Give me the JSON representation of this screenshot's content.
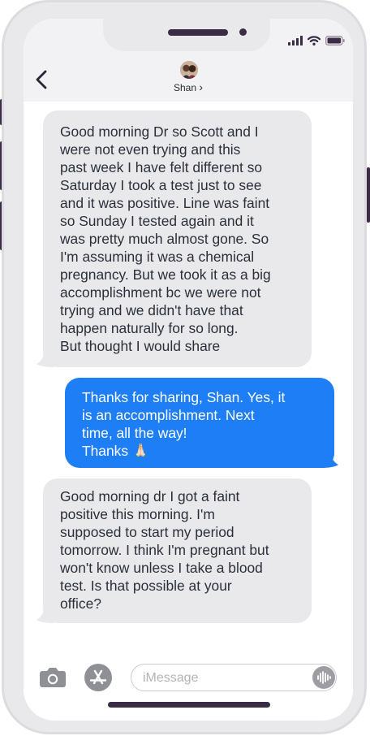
{
  "contact": {
    "name": "Shan",
    "chevron": "›"
  },
  "status": {
    "icons": [
      "cellular-signal-icon",
      "wifi-icon",
      "battery-icon"
    ]
  },
  "messages": [
    {
      "direction": "incoming",
      "text": "Good morning Dr so Scott and I\nwere not even trying and this\npast week I have felt different so\nSaturday I took a test just to see\nand it was positive. Line was faint\nso Sunday I tested again and it\nwas pretty much almost gone. So\nI'm assuming it was a chemical\npregnancy. But we took it as a big\naccomplishment bc we were not\ntrying and we didn't have that\nhappen naturally for so long.\nBut thought I would share"
    },
    {
      "direction": "outgoing",
      "text": "Thanks for sharing, Shan. Yes, it\nis an accomplishment. Next\ntime, all the way!\nThanks 🙏🏻"
    },
    {
      "direction": "incoming",
      "text": "Good morning dr I got a faint\npositive this morning. I'm\nsupposed to start my period\ntomorrow. I think I'm pregnant but\nwon't know unless I take a blood\ntest. Is that possible at your\noffice?"
    }
  ],
  "composer": {
    "placeholder": "iMessage"
  },
  "colors": {
    "incoming_bubble": "#e9e9eb",
    "outgoing_bubble": "#1e7ef5",
    "frame": "#3a2c44",
    "phone_body": "#e9e8eb"
  }
}
